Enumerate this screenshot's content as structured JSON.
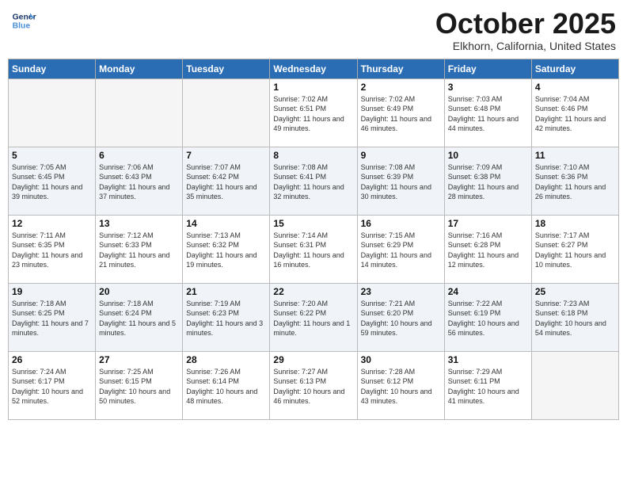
{
  "header": {
    "logo_line1": "General",
    "logo_line2": "Blue",
    "month": "October 2025",
    "location": "Elkhorn, California, United States"
  },
  "days_of_week": [
    "Sunday",
    "Monday",
    "Tuesday",
    "Wednesday",
    "Thursday",
    "Friday",
    "Saturday"
  ],
  "weeks": [
    {
      "days": [
        {
          "num": "",
          "empty": true
        },
        {
          "num": "",
          "empty": true
        },
        {
          "num": "",
          "empty": true
        },
        {
          "num": "1",
          "sunrise": "7:02 AM",
          "sunset": "6:51 PM",
          "daylight": "11 hours and 49 minutes."
        },
        {
          "num": "2",
          "sunrise": "7:02 AM",
          "sunset": "6:49 PM",
          "daylight": "11 hours and 46 minutes."
        },
        {
          "num": "3",
          "sunrise": "7:03 AM",
          "sunset": "6:48 PM",
          "daylight": "11 hours and 44 minutes."
        },
        {
          "num": "4",
          "sunrise": "7:04 AM",
          "sunset": "6:46 PM",
          "daylight": "11 hours and 42 minutes."
        }
      ]
    },
    {
      "alt": true,
      "days": [
        {
          "num": "5",
          "sunrise": "7:05 AM",
          "sunset": "6:45 PM",
          "daylight": "11 hours and 39 minutes."
        },
        {
          "num": "6",
          "sunrise": "7:06 AM",
          "sunset": "6:43 PM",
          "daylight": "11 hours and 37 minutes."
        },
        {
          "num": "7",
          "sunrise": "7:07 AM",
          "sunset": "6:42 PM",
          "daylight": "11 hours and 35 minutes."
        },
        {
          "num": "8",
          "sunrise": "7:08 AM",
          "sunset": "6:41 PM",
          "daylight": "11 hours and 32 minutes."
        },
        {
          "num": "9",
          "sunrise": "7:08 AM",
          "sunset": "6:39 PM",
          "daylight": "11 hours and 30 minutes."
        },
        {
          "num": "10",
          "sunrise": "7:09 AM",
          "sunset": "6:38 PM",
          "daylight": "11 hours and 28 minutes."
        },
        {
          "num": "11",
          "sunrise": "7:10 AM",
          "sunset": "6:36 PM",
          "daylight": "11 hours and 26 minutes."
        }
      ]
    },
    {
      "days": [
        {
          "num": "12",
          "sunrise": "7:11 AM",
          "sunset": "6:35 PM",
          "daylight": "11 hours and 23 minutes."
        },
        {
          "num": "13",
          "sunrise": "7:12 AM",
          "sunset": "6:33 PM",
          "daylight": "11 hours and 21 minutes."
        },
        {
          "num": "14",
          "sunrise": "7:13 AM",
          "sunset": "6:32 PM",
          "daylight": "11 hours and 19 minutes."
        },
        {
          "num": "15",
          "sunrise": "7:14 AM",
          "sunset": "6:31 PM",
          "daylight": "11 hours and 16 minutes."
        },
        {
          "num": "16",
          "sunrise": "7:15 AM",
          "sunset": "6:29 PM",
          "daylight": "11 hours and 14 minutes."
        },
        {
          "num": "17",
          "sunrise": "7:16 AM",
          "sunset": "6:28 PM",
          "daylight": "11 hours and 12 minutes."
        },
        {
          "num": "18",
          "sunrise": "7:17 AM",
          "sunset": "6:27 PM",
          "daylight": "11 hours and 10 minutes."
        }
      ]
    },
    {
      "alt": true,
      "days": [
        {
          "num": "19",
          "sunrise": "7:18 AM",
          "sunset": "6:25 PM",
          "daylight": "11 hours and 7 minutes."
        },
        {
          "num": "20",
          "sunrise": "7:18 AM",
          "sunset": "6:24 PM",
          "daylight": "11 hours and 5 minutes."
        },
        {
          "num": "21",
          "sunrise": "7:19 AM",
          "sunset": "6:23 PM",
          "daylight": "11 hours and 3 minutes."
        },
        {
          "num": "22",
          "sunrise": "7:20 AM",
          "sunset": "6:22 PM",
          "daylight": "11 hours and 1 minute."
        },
        {
          "num": "23",
          "sunrise": "7:21 AM",
          "sunset": "6:20 PM",
          "daylight": "10 hours and 59 minutes."
        },
        {
          "num": "24",
          "sunrise": "7:22 AM",
          "sunset": "6:19 PM",
          "daylight": "10 hours and 56 minutes."
        },
        {
          "num": "25",
          "sunrise": "7:23 AM",
          "sunset": "6:18 PM",
          "daylight": "10 hours and 54 minutes."
        }
      ]
    },
    {
      "days": [
        {
          "num": "26",
          "sunrise": "7:24 AM",
          "sunset": "6:17 PM",
          "daylight": "10 hours and 52 minutes."
        },
        {
          "num": "27",
          "sunrise": "7:25 AM",
          "sunset": "6:15 PM",
          "daylight": "10 hours and 50 minutes."
        },
        {
          "num": "28",
          "sunrise": "7:26 AM",
          "sunset": "6:14 PM",
          "daylight": "10 hours and 48 minutes."
        },
        {
          "num": "29",
          "sunrise": "7:27 AM",
          "sunset": "6:13 PM",
          "daylight": "10 hours and 46 minutes."
        },
        {
          "num": "30",
          "sunrise": "7:28 AM",
          "sunset": "6:12 PM",
          "daylight": "10 hours and 43 minutes."
        },
        {
          "num": "31",
          "sunrise": "7:29 AM",
          "sunset": "6:11 PM",
          "daylight": "10 hours and 41 minutes."
        },
        {
          "num": "",
          "empty": true
        }
      ]
    }
  ],
  "labels": {
    "sunrise_prefix": "Sunrise: ",
    "sunset_prefix": "Sunset: ",
    "daylight_label": "Daylight: "
  }
}
